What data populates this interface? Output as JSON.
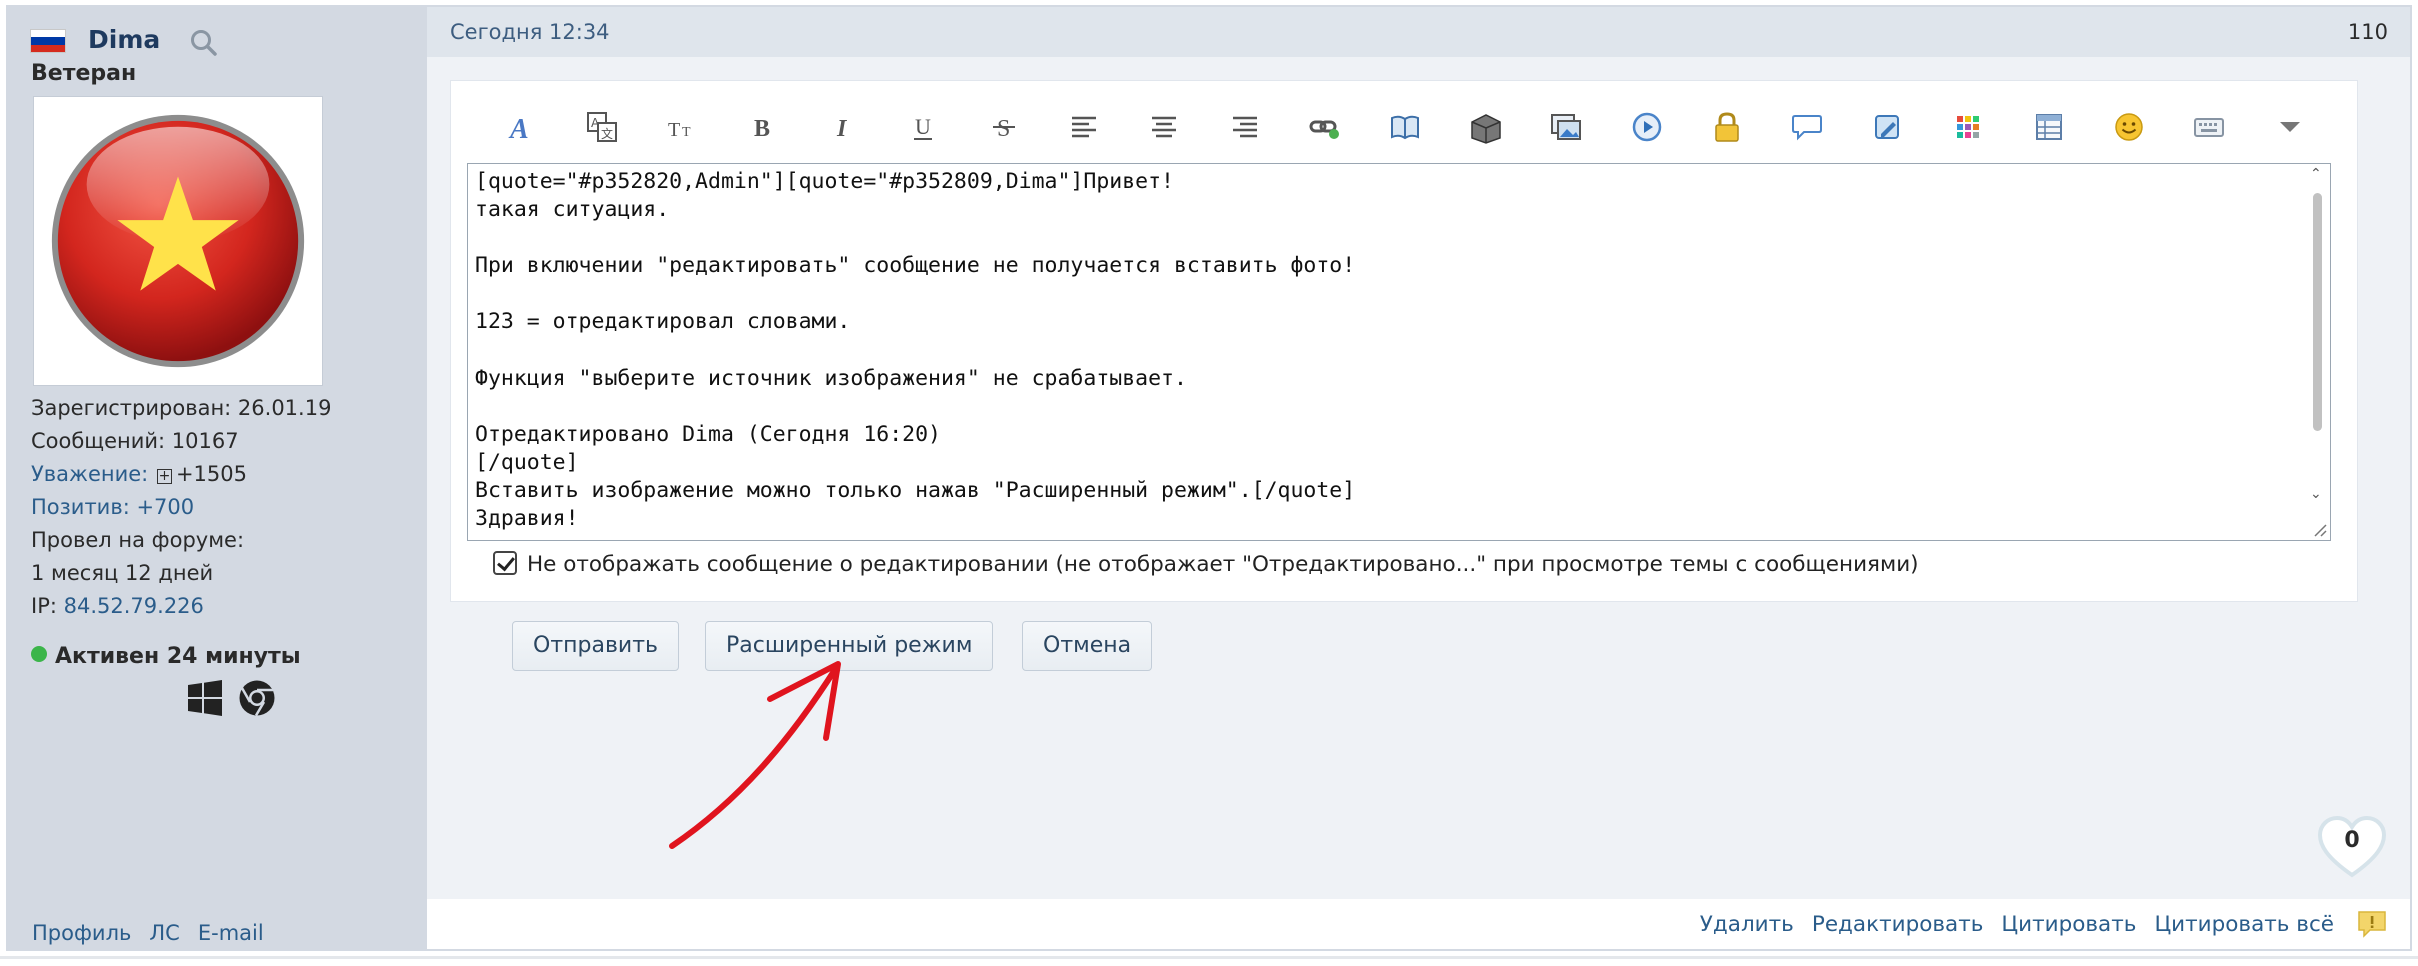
{
  "user": {
    "flag_colors": [
      "#ffffff",
      "#0039a6",
      "#d52b1e"
    ],
    "name": "Dima",
    "rank": "Ветеран",
    "avatar_icon": "vietnam-flag-star-ball",
    "registered": "Зарегистрирован: 26.01.19",
    "messages": "Сообщений: 10167",
    "respect_label": "Уважение:",
    "respect_value": "+1505",
    "positive": "Позитив: +700",
    "time_on_forum_label": "Провел на форуме:",
    "time_on_forum_value": "1 месяц 12 дней",
    "ip_label": "IP:",
    "ip_value": "84.52.79.226",
    "status": "Активен 24 минуты",
    "status_color": "#3bb54a",
    "os_icons": [
      "windows-icon",
      "chrome-icon"
    ],
    "links": {
      "profile": "Профиль",
      "pm": "ЛС",
      "email": "E-mail"
    }
  },
  "post": {
    "date": "Сегодня 12:34",
    "number": "110"
  },
  "editor": {
    "toolbar_icons": [
      "font-color-icon",
      "translate-icon",
      "font-size-icon",
      "bold-icon",
      "italic-icon",
      "underline-icon",
      "strikethrough-icon",
      "align-left-icon",
      "align-center-icon",
      "align-right-icon",
      "link-icon",
      "book-icon",
      "archive-box-icon",
      "image-icon",
      "video-play-icon",
      "lock-icon",
      "speech-bubble-icon",
      "edit-quote-icon",
      "color-grid-icon",
      "table-icon",
      "smiley-icon",
      "keyboard-icon",
      "more-arrow-icon"
    ],
    "lines": [
      "[quote=\"#p352820,Admin\"][quote=\"#p352809,Dima\"]Привет!",
      "такая ситуация.",
      "",
      "При включении \"редактировать\" сообщение не получается вставить фото!",
      "",
      "123 = отредактировал словами.",
      "",
      "Функция \"выберите источник изображения\" не срабатывает.",
      "",
      "Отредактировано Dima (Сегодня 16:20)",
      "[/quote]",
      "Вставить изображение можно только нажав \"Расширенный режим\".[/quote]",
      "Здравия!"
    ],
    "checkbox_label": "Не отображать сообщение о редактировании (не отображает \"Отредактировано...\" при просмотре темы с сообщениями)",
    "checkbox_checked": true
  },
  "buttons": {
    "submit": "Отправить",
    "advanced": "Расширенный режим",
    "cancel": "Отмена"
  },
  "annotation": {
    "color": "#e0141e"
  },
  "likes": {
    "count": "0"
  },
  "footer": {
    "delete": "Удалить",
    "edit": "Редактировать",
    "quote": "Цитировать",
    "quote_all": "Цитировать всё",
    "report_icon": "report-icon"
  }
}
